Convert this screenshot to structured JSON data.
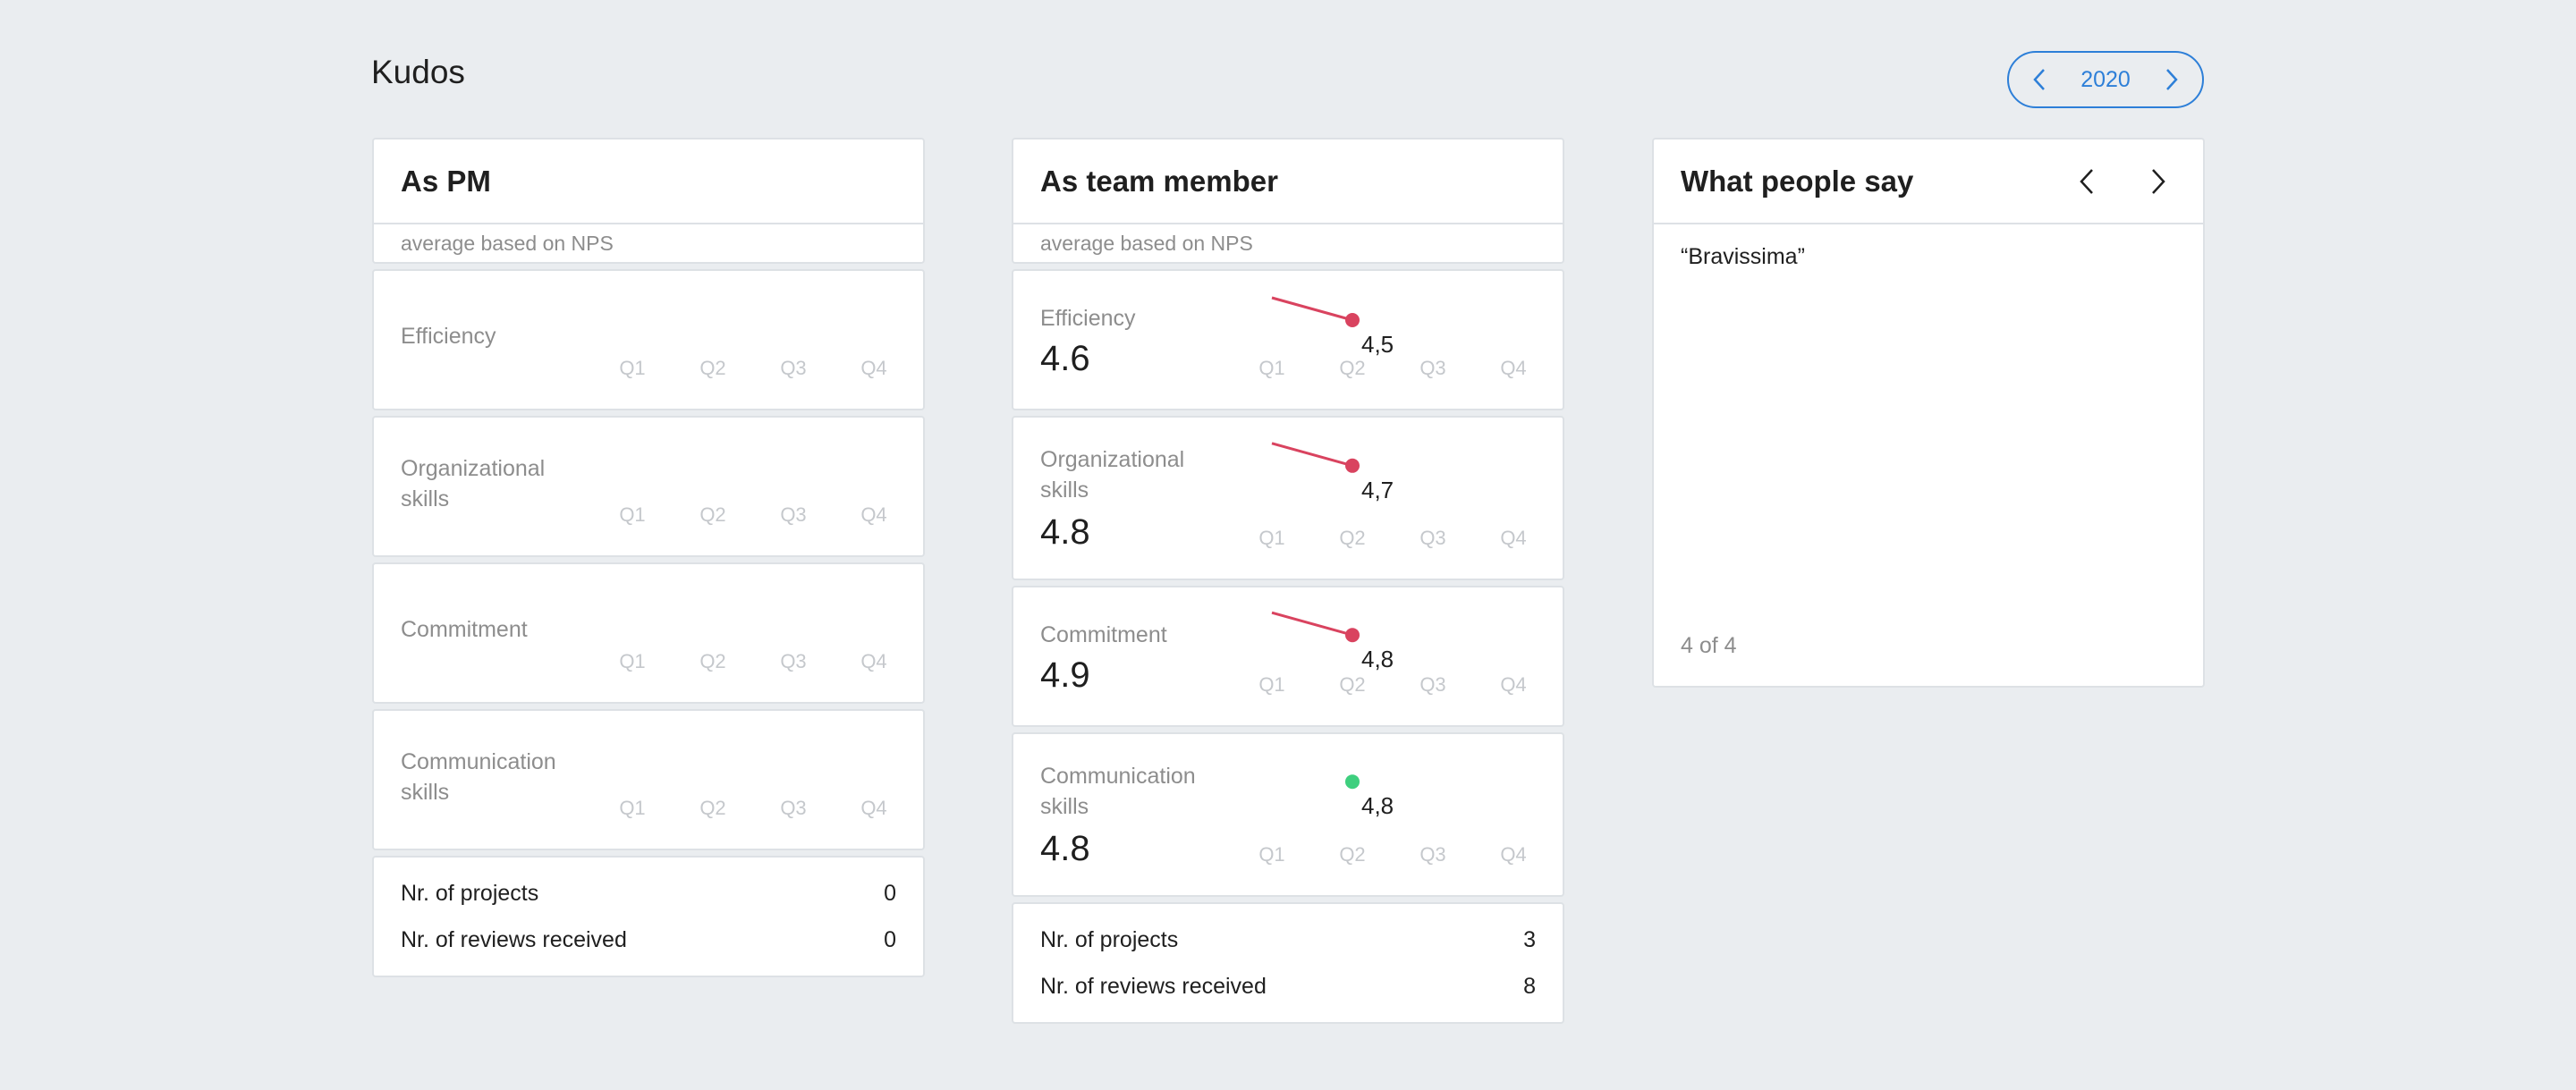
{
  "page": {
    "title": "Kudos"
  },
  "year_nav": {
    "year": "2020",
    "prev_icon": "chevron-left-icon",
    "next_icon": "chevron-right-icon"
  },
  "quarters": [
    "Q1",
    "Q2",
    "Q3",
    "Q4"
  ],
  "as_pm": {
    "title": "As PM",
    "subtitle": "average based on NPS",
    "metrics": [
      {
        "label": "Efficiency",
        "value": ""
      },
      {
        "label": "Organizational skills",
        "value": ""
      },
      {
        "label": "Commitment",
        "value": ""
      },
      {
        "label": "Communication skills",
        "value": ""
      }
    ],
    "stats": [
      {
        "label": "Nr. of projects",
        "value": "0"
      },
      {
        "label": "Nr. of reviews received",
        "value": "0"
      }
    ]
  },
  "as_team_member": {
    "title": "As team member",
    "subtitle": "average based on NPS",
    "metrics": [
      {
        "label": "Efficiency",
        "value": "4.6"
      },
      {
        "label": "Organizational skills",
        "value": "4.8"
      },
      {
        "label": "Commitment",
        "value": "4.9"
      },
      {
        "label": "Communication skills",
        "value": "4.8"
      }
    ],
    "stats": [
      {
        "label": "Nr. of projects",
        "value": "3"
      },
      {
        "label": "Nr. of reviews received",
        "value": "8"
      }
    ]
  },
  "what_people_say": {
    "title": "What people say",
    "quote": "“Bravissima”",
    "counter": "4 of 4"
  },
  "colors": {
    "accent": "#2d7fd8",
    "trend_down": "#d9435f",
    "trend_up": "#3ecf7e"
  },
  "chart_data": [
    {
      "type": "line",
      "x": [
        "Q1",
        "Q2",
        "Q3",
        "Q4"
      ],
      "series": [
        {
          "values": [
            null,
            4.5,
            null,
            null
          ]
        }
      ],
      "labels": [
        "4,5"
      ],
      "trend": "down"
    },
    {
      "type": "line",
      "x": [
        "Q1",
        "Q2",
        "Q3",
        "Q4"
      ],
      "series": [
        {
          "values": [
            null,
            4.7,
            null,
            null
          ]
        }
      ],
      "labels": [
        "4,7"
      ],
      "trend": "down"
    },
    {
      "type": "line",
      "x": [
        "Q1",
        "Q2",
        "Q3",
        "Q4"
      ],
      "series": [
        {
          "values": [
            null,
            4.8,
            null,
            null
          ]
        }
      ],
      "labels": [
        "4,8"
      ],
      "trend": "down"
    },
    {
      "type": "scatter",
      "x": [
        "Q1",
        "Q2",
        "Q3",
        "Q4"
      ],
      "series": [
        {
          "values": [
            null,
            4.8,
            null,
            null
          ]
        }
      ],
      "labels": [
        "4,8"
      ],
      "trend": "up"
    }
  ]
}
